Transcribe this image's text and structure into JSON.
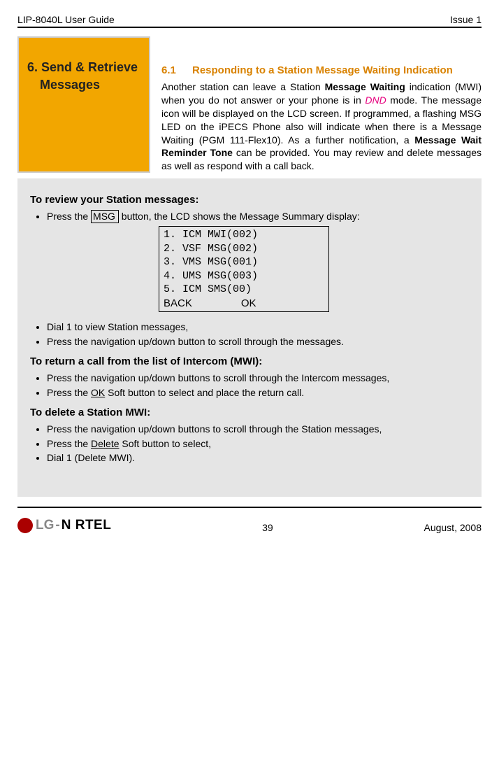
{
  "header": {
    "left": "LIP-8040L User Guide",
    "right": "Issue 1"
  },
  "sectionBox": {
    "line1": "6. Send & Retrieve",
    "line2": "Messages"
  },
  "heading": {
    "num": "6.1",
    "text": "Responding to a Station Message Waiting Indication"
  },
  "intro": {
    "part1": "Another station can leave a Station ",
    "bold1": "Message Waiting",
    "part2": " indication (MWI) when you do not answer or your phone is in ",
    "dnd": "DND",
    "part3": " mode.  The message icon will be displayed on the LCD screen. If programmed, a flashing MSG LED on the iPECS Phone also will indicate when there is a Message Waiting (PGM 111-Flex10).  As a further notification, a ",
    "bold2": "Message Wait Reminder Tone",
    "part4": " can be provided.  You may review and delete messages as well as respond with a call back."
  },
  "review": {
    "title": "To review your Station messages:",
    "item1a": "Press the ",
    "msgBtn": "MSG",
    "item1b": " button, the LCD shows the Message Summary display:",
    "lcd": {
      "l1": "1. ICM MWI(002)",
      "l2": "2. VSF MSG(002)",
      "l3": "3. VMS MSG(001)",
      "l4": "4. UMS MSG(003)",
      "l5": "5. ICM SMS(00)",
      "back": "BACK",
      "ok": "OK"
    },
    "item2": "Dial 1 to view Station messages,",
    "item3": "Press the navigation up/down button to scroll through the messages."
  },
  "returnCall": {
    "title": "To return a call from the list of Intercom (MWI):",
    "item1": "Press the navigation up/down buttons to scroll through the Intercom messages,",
    "item2a": "Press the ",
    "okBtn": "OK",
    "item2b": " Soft button to select and place the return call."
  },
  "deleteMwi": {
    "title": "To delete a Station MWI:",
    "item1": "Press the navigation up/down buttons to scroll through the Station messages,",
    "item2a": "Press the ",
    "delBtn": "Delete",
    "item2b": " Soft button to select,",
    "item3": "Dial 1 (Delete MWI)."
  },
  "footer": {
    "logoLg": "LG",
    "logoNortel": "N   RTEL",
    "page": "39",
    "date": "August, 2008"
  }
}
